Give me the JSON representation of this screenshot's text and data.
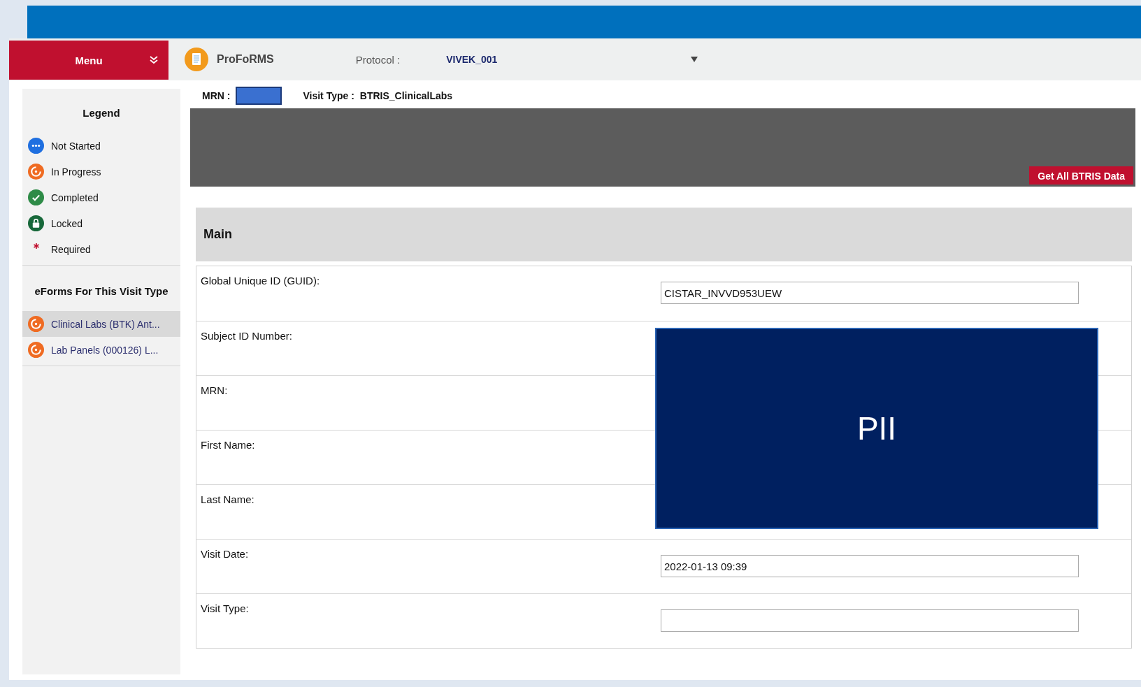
{
  "header": {
    "menu_label": "Menu",
    "app_name": "ProFoRMS",
    "protocol_label": "Protocol :",
    "protocol_value": "VIVEK_001"
  },
  "visit_info": {
    "mrn_label": "MRN :",
    "visit_type_label": "Visit Type :",
    "visit_type_value": "BTRIS_ClinicalLabs"
  },
  "legend": {
    "title": "Legend",
    "items": [
      {
        "kind": "not-started",
        "label": "Not Started"
      },
      {
        "kind": "in-progress",
        "label": "In Progress"
      },
      {
        "kind": "completed",
        "label": "Completed"
      },
      {
        "kind": "locked",
        "label": "Locked"
      },
      {
        "kind": "required",
        "label": "Required"
      }
    ]
  },
  "eforms": {
    "title": "eForms For This Visit Type",
    "items": [
      {
        "kind": "in-progress",
        "label": "Clinical Labs (BTK) Ant...",
        "selected": true
      },
      {
        "kind": "in-progress",
        "label": "Lab Panels (000126) L...",
        "selected": false
      }
    ]
  },
  "action_button": "Get All BTRIS Data",
  "section": {
    "title": "Main",
    "rows": [
      {
        "kind": "field",
        "label": "Global Unique ID (GUID):",
        "value": "CISTAR_INVVD953UEW"
      },
      {
        "kind": "redacted",
        "label": "Subject ID Number:"
      },
      {
        "kind": "redacted",
        "label": "MRN:"
      },
      {
        "kind": "redacted",
        "label": "First Name:"
      },
      {
        "kind": "redacted",
        "label": "Last Name:"
      },
      {
        "kind": "field",
        "label": "Visit Date:",
        "value": "2022-01-13 09:39"
      },
      {
        "kind": "field",
        "label": "Visit Type:"
      }
    ]
  },
  "redaction": {
    "label": "PII"
  }
}
